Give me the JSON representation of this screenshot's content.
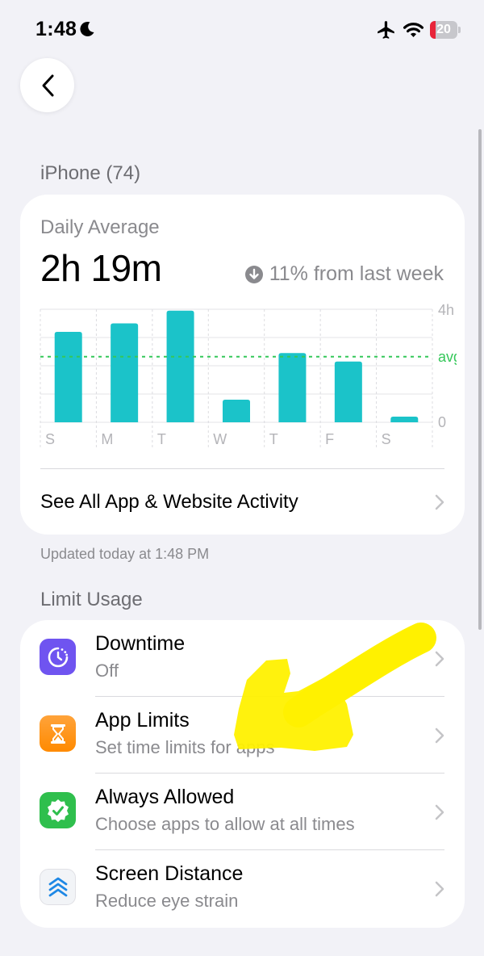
{
  "status_bar": {
    "time": "1:48",
    "battery_level": "20",
    "battery_fraction": 0.2
  },
  "device_header": "iPhone (74)",
  "usage": {
    "daily_label": "Daily Average",
    "daily_value": "2h 19m",
    "trend_text": "11% from last week",
    "see_all_label": "See All App & Website Activity"
  },
  "chart_data": {
    "type": "bar",
    "categories": [
      "S",
      "M",
      "T",
      "W",
      "T",
      "F",
      "S"
    ],
    "values": [
      3.2,
      3.5,
      3.95,
      0.8,
      2.45,
      2.15,
      0.2
    ],
    "unit": "hours",
    "ylim": [
      0,
      4
    ],
    "y_ticks": [
      "4h",
      "0"
    ],
    "average_label": "avg",
    "average_value": 2.32,
    "bar_color": "#1bc3c9",
    "average_color": "#34c759",
    "grid": true
  },
  "updated_text": "Updated today at 1:48 PM",
  "limit_header": "Limit Usage",
  "limits": [
    {
      "title": "Downtime",
      "subtitle": "Off",
      "icon": "downtime-icon",
      "color": "#7a5af5"
    },
    {
      "title": "App Limits",
      "subtitle": "Set time limits for apps",
      "icon": "hourglass-icon",
      "color": "#ff9500"
    },
    {
      "title": "Always Allowed",
      "subtitle": "Choose apps to allow at all times",
      "icon": "checkmark-seal-icon",
      "color": "#30c04f"
    },
    {
      "title": "Screen Distance",
      "subtitle": "Reduce eye strain",
      "icon": "chevrons-up-icon",
      "color": "#f2f2f7"
    }
  ],
  "annotation": {
    "type": "arrow",
    "color": "#fff100"
  }
}
